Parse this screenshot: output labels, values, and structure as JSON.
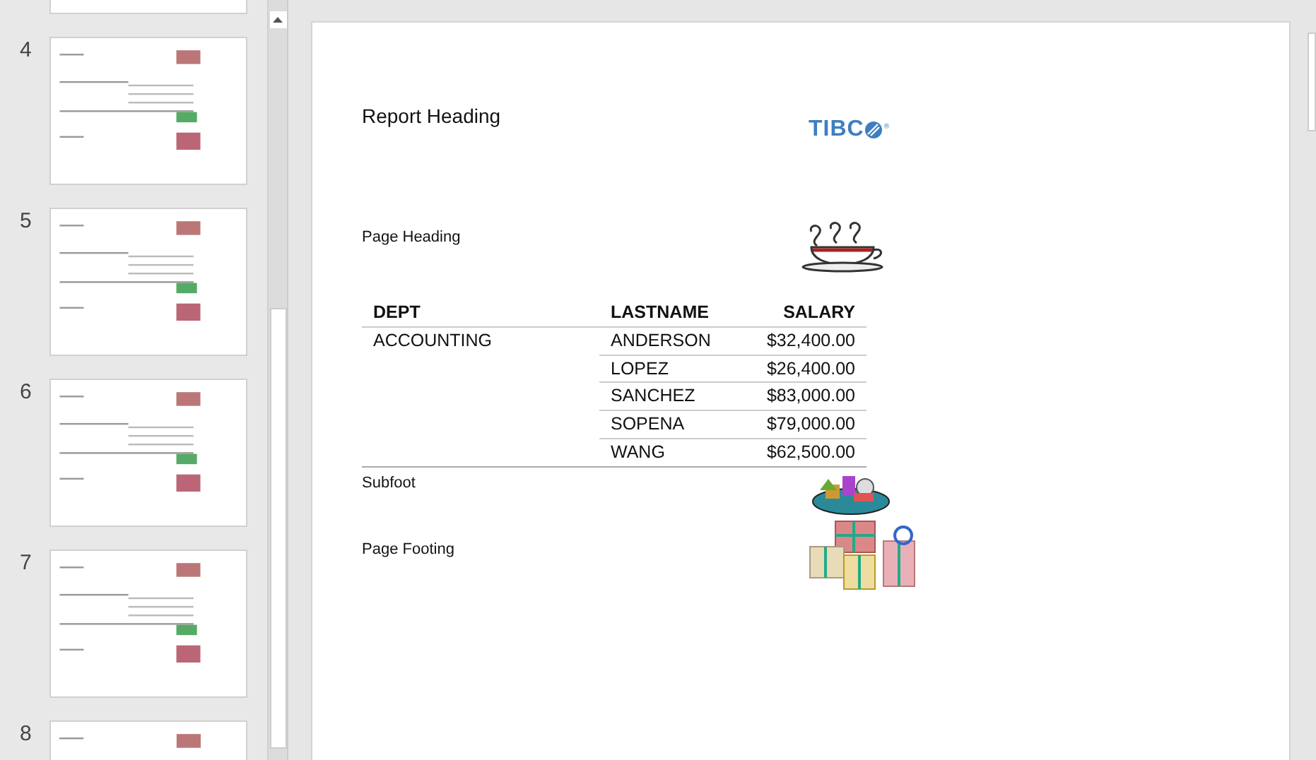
{
  "thumbnails": [
    {
      "number": "4"
    },
    {
      "number": "5"
    },
    {
      "number": "6"
    },
    {
      "number": "7"
    },
    {
      "number": "8"
    }
  ],
  "slide": {
    "report_heading": "Report Heading",
    "logo": {
      "text": "TIBC",
      "mark": "®"
    },
    "page_heading": "Page Heading",
    "table": {
      "columns": [
        "DEPT",
        "LASTNAME",
        "SALARY"
      ],
      "rows": [
        [
          "ACCOUNTING",
          "ANDERSON",
          "$32,400.00"
        ],
        [
          "",
          "LOPEZ",
          "$26,400.00"
        ],
        [
          "",
          "SANCHEZ",
          "$83,000.00"
        ],
        [
          "",
          "SOPENA",
          "$79,000.00"
        ],
        [
          "",
          "WANG",
          "$62,500.00"
        ]
      ]
    },
    "subfoot": "Subfoot",
    "page_footing": "Page Footing"
  }
}
